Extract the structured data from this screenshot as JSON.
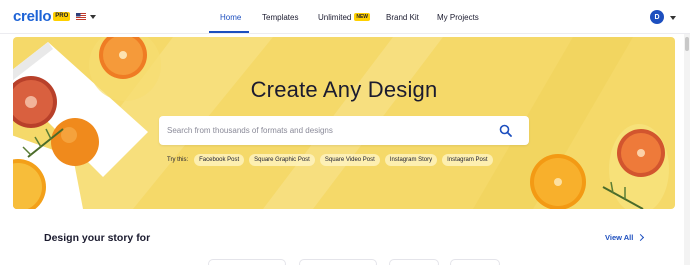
{
  "brand": {
    "logo_text": "crello",
    "badge": "PRO"
  },
  "nav": {
    "items": [
      {
        "label": "Home",
        "active": true
      },
      {
        "label": "Templates"
      },
      {
        "label": "Unlimited",
        "badge": "NEW"
      },
      {
        "label": "Brand Kit"
      },
      {
        "label": "My Projects"
      }
    ]
  },
  "user": {
    "initial": "D"
  },
  "hero": {
    "title": "Create Any Design",
    "search_placeholder": "Search from thousands of formats and designs",
    "try_label": "Try this:",
    "chips": [
      "Facebook Post",
      "Square Graphic Post",
      "Square Video Post",
      "Instagram Story",
      "Instagram Post"
    ]
  },
  "section": {
    "title": "Design your story for",
    "view_all": "View All"
  },
  "colors": {
    "accent": "#1d4fbf",
    "hero_bg": "#f5d969",
    "badge": "#ffd000"
  }
}
